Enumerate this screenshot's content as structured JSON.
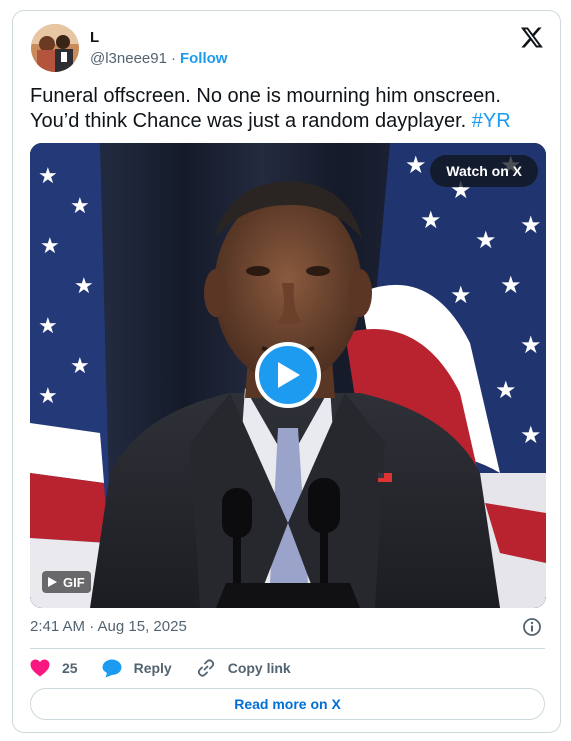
{
  "author": {
    "display_name": "L",
    "handle": "@l3neee91",
    "separator": "·",
    "follow_label": "Follow"
  },
  "tweet": {
    "text": "Funeral offscreen. No one is mourning him onscreen. You’d think Chance was just a random dayplayer.",
    "hashtag": "#YR"
  },
  "media": {
    "watch_label": "Watch on X",
    "gif_label": "GIF"
  },
  "meta": {
    "timestamp": "2:41 AM · Aug 15, 2025"
  },
  "actions": {
    "like_count": "25",
    "reply_label": "Reply",
    "copy_link_label": "Copy link"
  },
  "footer": {
    "read_more_label": "Read more on X"
  },
  "icons": {
    "logo": "x-logo-icon",
    "info": "info-icon",
    "like": "heart-icon",
    "reply": "reply-bubble-icon",
    "copy": "link-icon",
    "play": "play-icon"
  },
  "colors": {
    "accent": "#1d9bf0",
    "like": "#f91880",
    "muted": "#536471",
    "border": "#cfd9de",
    "text": "#0f1419"
  }
}
